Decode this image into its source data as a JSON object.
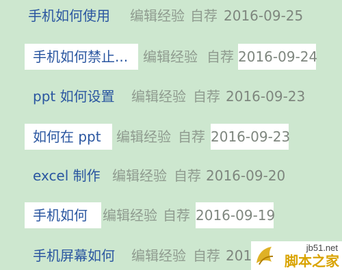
{
  "rows": [
    {
      "title": "手机如何使用",
      "editor": "编辑经验",
      "source": "自荐",
      "date": "2016-09-25"
    },
    {
      "title": "手机如何禁止...",
      "editor": "编辑经验",
      "source": "自荐",
      "date": "2016-09-24"
    },
    {
      "title": "ppt 如何设置",
      "editor": "编辑经验",
      "source": "自荐",
      "date": "2016-09-23"
    },
    {
      "title": "如何在 ppt",
      "editor": "编辑经验",
      "source": "自荐",
      "date": "2016-09-23"
    },
    {
      "title": "excel 制作",
      "editor": "编辑经验",
      "source": "自荐",
      "date": "2016-09-20"
    },
    {
      "title": "手机如何",
      "editor": "编辑经验",
      "source": "自荐",
      "date": "2016-09-19"
    },
    {
      "title": "手机屏幕如何",
      "editor": "编辑经验",
      "source": "自荐",
      "date": "201"
    }
  ],
  "watermark": {
    "domain": "jb51.net",
    "text": "脚本之家"
  },
  "colors": {
    "background": "#cde7cf",
    "title": "#2a56a0",
    "meta": "#8f9b8f",
    "highlight": "#ffffff"
  }
}
